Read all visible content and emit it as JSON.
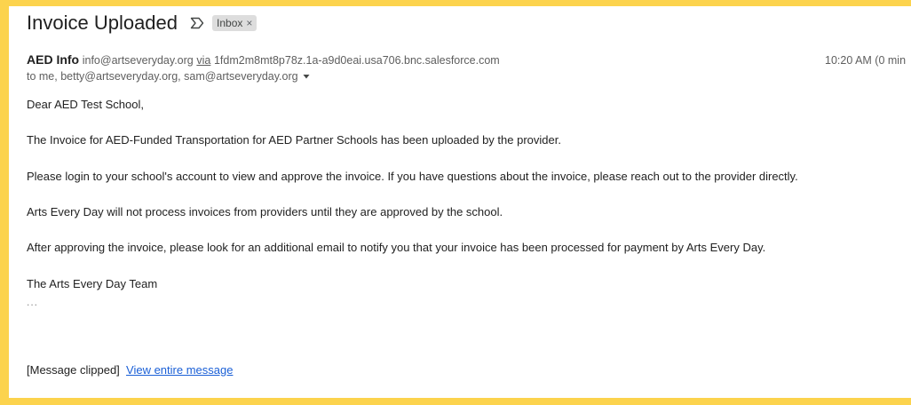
{
  "email": {
    "subject": "Invoice Uploaded",
    "label": "Inbox",
    "label_close": "×",
    "sender": {
      "name": "AED Info",
      "email": "info@artseveryday.org",
      "via_label": "via",
      "via_domain": "1fdm2m8mt8p78z.1a-a9d0eai.usa706.bnc.salesforce.com"
    },
    "timestamp": "10:20 AM (0 min",
    "recipients": "to me, betty@artseveryday.org, sam@artseveryday.org",
    "body": {
      "greeting": "Dear AED Test School,",
      "p1": "The Invoice for AED-Funded Transportation for AED Partner Schools has been uploaded by the provider.",
      "p2": "Please login to your school's account to view and approve the invoice. If you have questions about the invoice, please reach out to the provider directly.",
      "p3": "Arts Every Day will not process invoices from providers until they are approved by the school.",
      "p4": "After approving the invoice, please look for an additional email to notify you that your invoice has been processed for payment by Arts Every Day.",
      "signature": "The Arts Every Day Team",
      "trimmed": "..."
    },
    "clipped_text": "[Message clipped]",
    "view_entire": "View entire message"
  },
  "colors": {
    "border": "#fcd34d",
    "link": "#1a5fd6"
  },
  "icons": {
    "important": "important-marker-icon",
    "caret": "caret-down-icon"
  }
}
